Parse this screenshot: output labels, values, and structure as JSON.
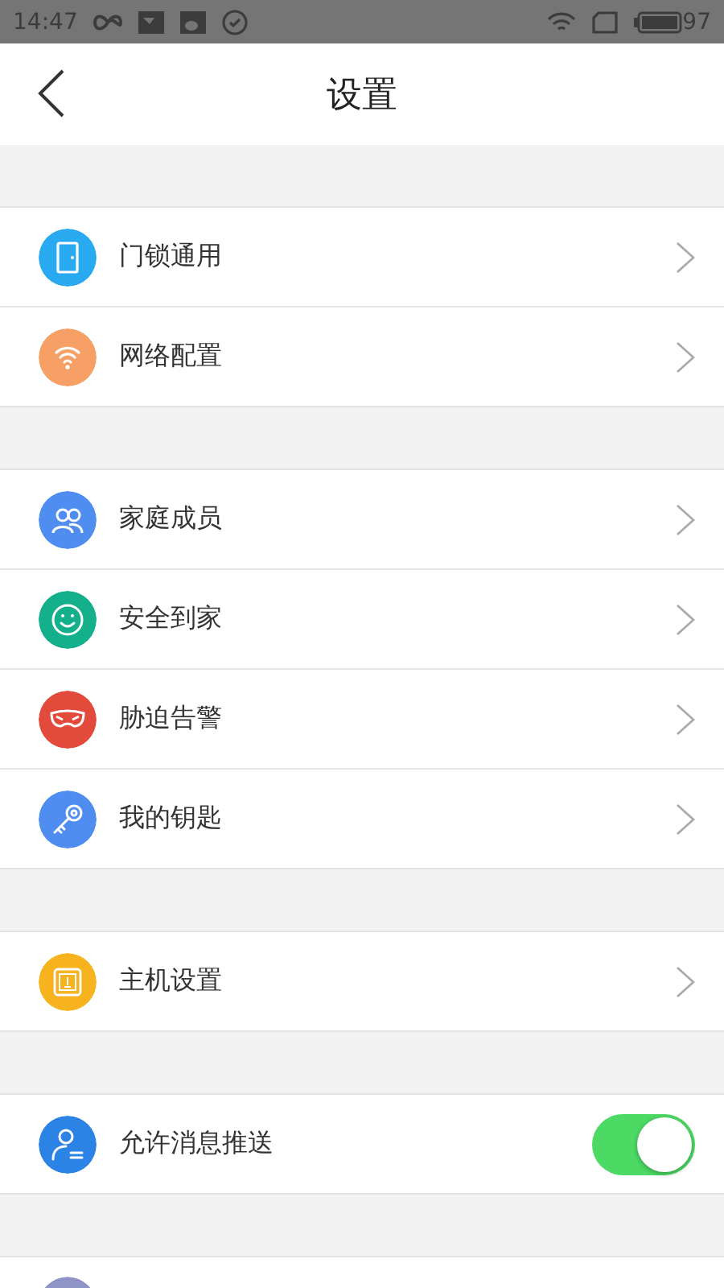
{
  "status_bar": {
    "time": "14:47",
    "battery": "97"
  },
  "header": {
    "title": "设置"
  },
  "groups": [
    {
      "items": [
        {
          "kind": "link",
          "color": "#29aaf0",
          "label": "门锁通用"
        },
        {
          "kind": "link",
          "color": "#f7a066",
          "label": "网络配置"
        }
      ]
    },
    {
      "items": [
        {
          "kind": "link",
          "color": "#4f8ef0",
          "label": "家庭成员"
        },
        {
          "kind": "link",
          "color": "#13b08b",
          "label": "安全到家"
        },
        {
          "kind": "link",
          "color": "#e24a3b",
          "label": "胁迫告警"
        },
        {
          "kind": "link",
          "color": "#4f8ef0",
          "label": "我的钥匙"
        }
      ]
    },
    {
      "items": [
        {
          "kind": "link",
          "color": "#f7b31d",
          "label": "主机设置"
        }
      ]
    },
    {
      "items": [
        {
          "kind": "toggle",
          "color": "#2c83e6",
          "label": "允许消息推送",
          "on": true
        }
      ]
    },
    {
      "items": [
        {
          "kind": "partial",
          "color": "#8e93c8"
        }
      ]
    }
  ]
}
